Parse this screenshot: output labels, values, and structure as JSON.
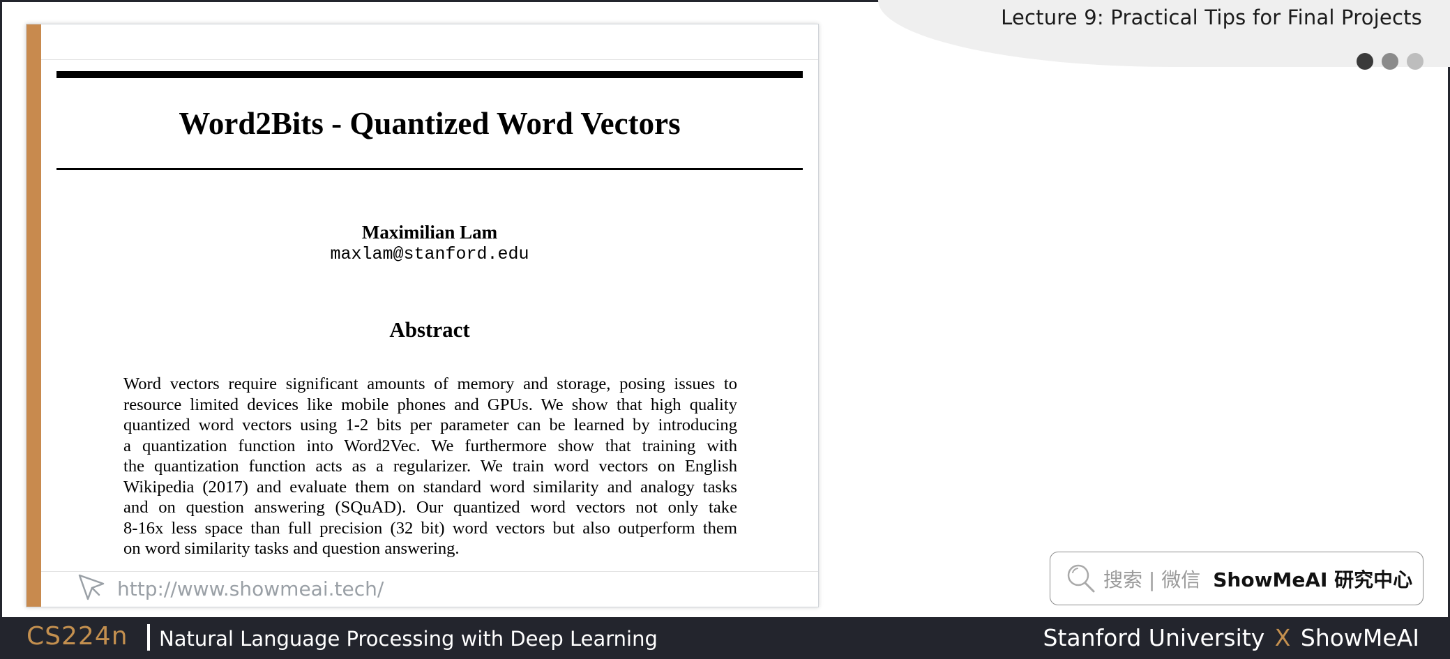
{
  "header": {
    "lecture_title": "Lecture 9: Practical Tips for Final Projects"
  },
  "paper": {
    "title": "Word2Bits - Quantized Word Vectors",
    "author": "Maximilian Lam",
    "email": "maxlam@stanford.edu",
    "abstract_heading": "Abstract",
    "abstract_lines": [
      "Word vectors require significant amounts of memory and storage, posing issues to",
      "resource limited devices like mobile phones and GPUs.  We show that high quality",
      "quantized word vectors using 1-2 bits per parameter can be learned by introducing",
      "a quantization function into Word2Vec.  We furthermore show that training with",
      "the quantization function acts as a regularizer.  We train word vectors on English",
      "Wikipedia (2017) and evaluate them on standard word similarity and analogy tasks",
      "and on question answering (SQuAD). Our quantized word vectors not only take",
      "8-16x less space than full precision (32 bit) word vectors but also outperform them",
      "on word similarity tasks and question answering."
    ],
    "url": "http://www.showmeai.tech/",
    "url_icon": "cursor-arrow-icon"
  },
  "search": {
    "icon": "search-icon",
    "hint": "搜索 | 微信",
    "brand": "ShowMeAI 研究中心"
  },
  "footer": {
    "course_code": "CS224n",
    "course_name": "Natural Language Processing with Deep Learning",
    "partner_left": "Stanford University",
    "partner_x": "X",
    "partner_right": "ShowMeAI"
  },
  "colors": {
    "accent": "#c88a4e",
    "dark_bar": "#23252d"
  }
}
